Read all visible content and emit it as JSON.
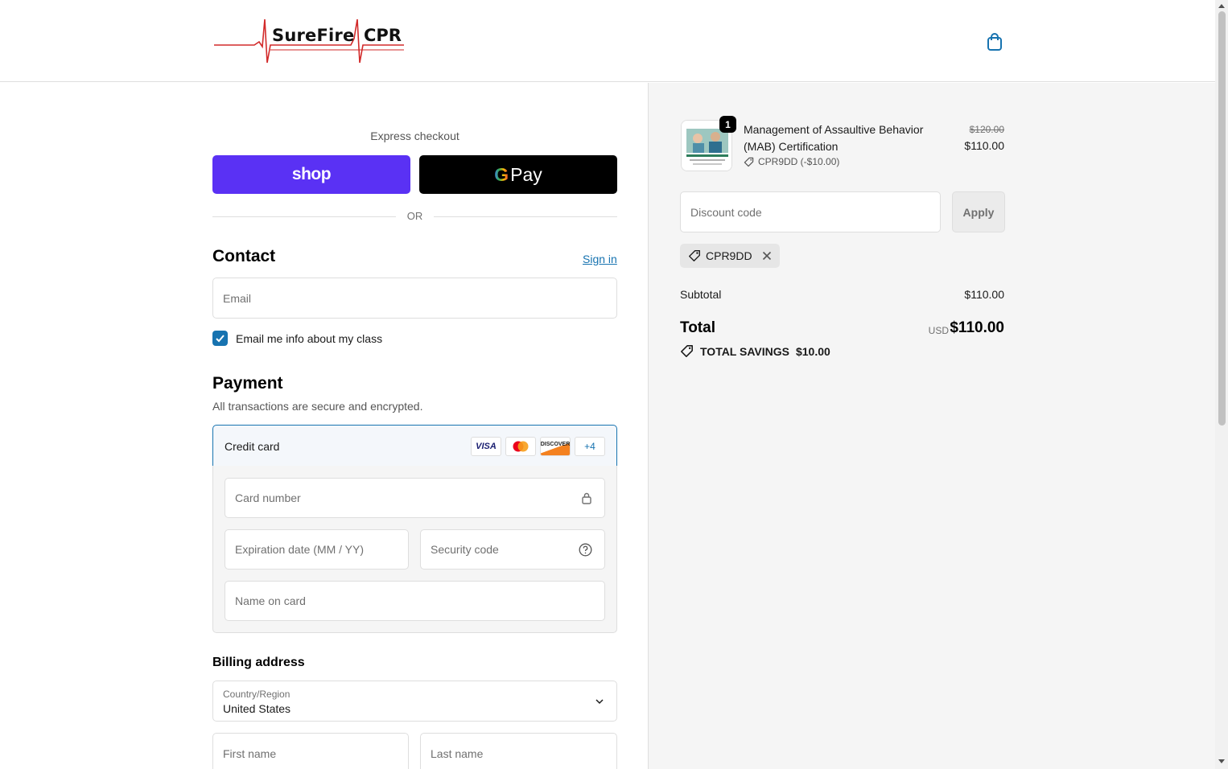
{
  "header": {
    "logo_text_1": "SureFire",
    "logo_text_2": "CPR",
    "cart_icon": "shopping-bag-icon"
  },
  "express": {
    "title": "Express checkout",
    "shop_label": "shop",
    "gpay_g": "G",
    "gpay_label": "Pay",
    "or_label": "OR"
  },
  "contact": {
    "title": "Contact",
    "sign_in": "Sign in",
    "email_placeholder": "Email",
    "email_opt_in_label": "Email me info about my class",
    "email_opt_in_checked": true
  },
  "payment": {
    "title": "Payment",
    "subtitle": "All transactions are secure and encrypted.",
    "method_label": "Credit card",
    "card_brands": [
      "VISA",
      "mastercard",
      "DISCOVER",
      "+4"
    ],
    "card_number_placeholder": "Card number",
    "expiry_placeholder": "Expiration date (MM / YY)",
    "security_placeholder": "Security code",
    "name_placeholder": "Name on card"
  },
  "billing": {
    "title": "Billing address",
    "country_label": "Country/Region",
    "country_value": "United States",
    "first_name_placeholder": "First name",
    "last_name_placeholder": "Last name"
  },
  "summary": {
    "product": {
      "name": "Management of Assaultive Behavior (MAB) Certification",
      "quantity": "1",
      "discount_tag": "CPR9DD (-$10.00)",
      "original_price": "$120.00",
      "price": "$110.00"
    },
    "discount_placeholder": "Discount code",
    "apply_label": "Apply",
    "applied_code": "CPR9DD",
    "subtotal_label": "Subtotal",
    "subtotal_value": "$110.00",
    "total_label": "Total",
    "currency": "USD",
    "total_value": "$110.00",
    "savings_label": "TOTAL SAVINGS",
    "savings_value": "$10.00"
  },
  "colors": {
    "accent": "#1773b0",
    "shop_purple": "#5a31f4",
    "logo_red": "#d22a2a"
  }
}
